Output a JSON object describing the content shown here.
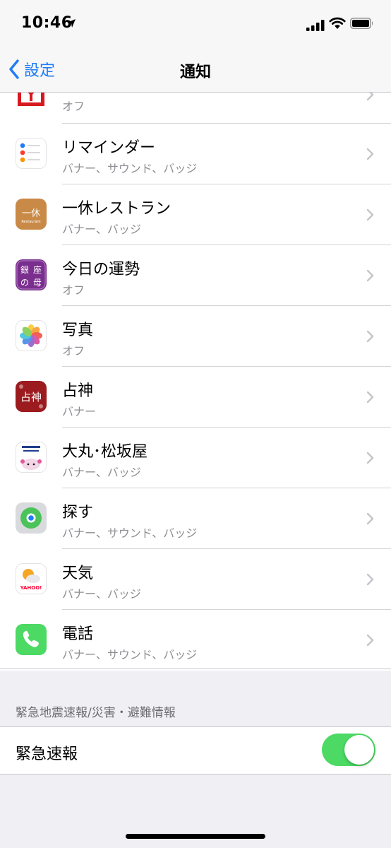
{
  "status_bar": {
    "time": "10:46"
  },
  "nav": {
    "back_label": "設定",
    "title": "通知"
  },
  "apps": [
    {
      "name": "",
      "status": "オフ",
      "icon": "yamato-icon"
    },
    {
      "name": "リマインダー",
      "status": "バナー、サウンド、バッジ",
      "icon": "reminders-icon"
    },
    {
      "name": "一休レストラン",
      "status": "バナー、バッジ",
      "icon": "ikyu-restaurant-icon",
      "icon_text": "一休",
      "icon_subtext": "Restaurant"
    },
    {
      "name": "今日の運勢",
      "status": "オフ",
      "icon": "ginza-fortune-icon",
      "icon_text": [
        "銀",
        "座",
        "の",
        "母"
      ]
    },
    {
      "name": "写真",
      "status": "オフ",
      "icon": "photos-icon"
    },
    {
      "name": "占神",
      "status": "バナー",
      "icon": "senshin-icon",
      "icon_text": "占神"
    },
    {
      "name": "大丸･松坂屋",
      "status": "バナー、バッジ",
      "icon": "daimaru-matsuzakaya-icon"
    },
    {
      "name": "探す",
      "status": "バナー、サウンド、バッジ",
      "icon": "find-my-icon"
    },
    {
      "name": "天気",
      "status": "バナー、バッジ",
      "icon": "yahoo-weather-icon",
      "icon_text": "YAHOO!"
    },
    {
      "name": "電話",
      "status": "バナー、サウンド、バッジ",
      "icon": "phone-icon"
    }
  ],
  "emergency": {
    "section_header": "緊急地震速報/災害・避難情報",
    "label": "緊急速報",
    "enabled": true
  },
  "colors": {
    "accent": "#1f7cf6",
    "toggle_on": "#4cd964",
    "secondary_text": "#8e8e93",
    "background": "#efeff4"
  }
}
